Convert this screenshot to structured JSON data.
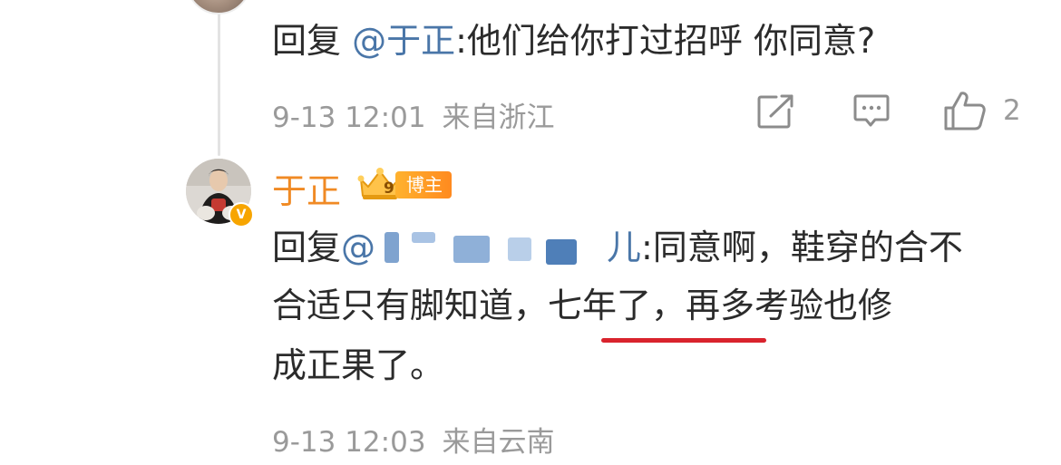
{
  "parent_comment": {
    "reply_prefix": "回复",
    "mention": "@于正",
    "text": ":他们给你打过招呼 你同意?",
    "time": "9-13 12:01",
    "location": "来自浙江",
    "like_count": "2",
    "icons": [
      "repost-icon",
      "comment-icon",
      "like-icon"
    ]
  },
  "reply_comment": {
    "username": "于正",
    "fan_level": "9",
    "badge_label": "博主",
    "reply_prefix": "回复",
    "mention_visible_tail": "儿",
    "line1_text": ":同意啊，鞋穿的合不",
    "line2_text_a": "合适只有脚知道，",
    "line2_highlight": "七年了，",
    "line2_text_b": "再多考验也修",
    "line3_text": "成正果了。",
    "time": "9-13 12:03",
    "location": "来自云南",
    "verified_badge": "V"
  },
  "colors": {
    "mention": "#4a76a8",
    "username": "#f08a24",
    "meta": "#9a9a9a",
    "highlight_underline": "#d9232d",
    "badge": "#ff8a1f"
  }
}
